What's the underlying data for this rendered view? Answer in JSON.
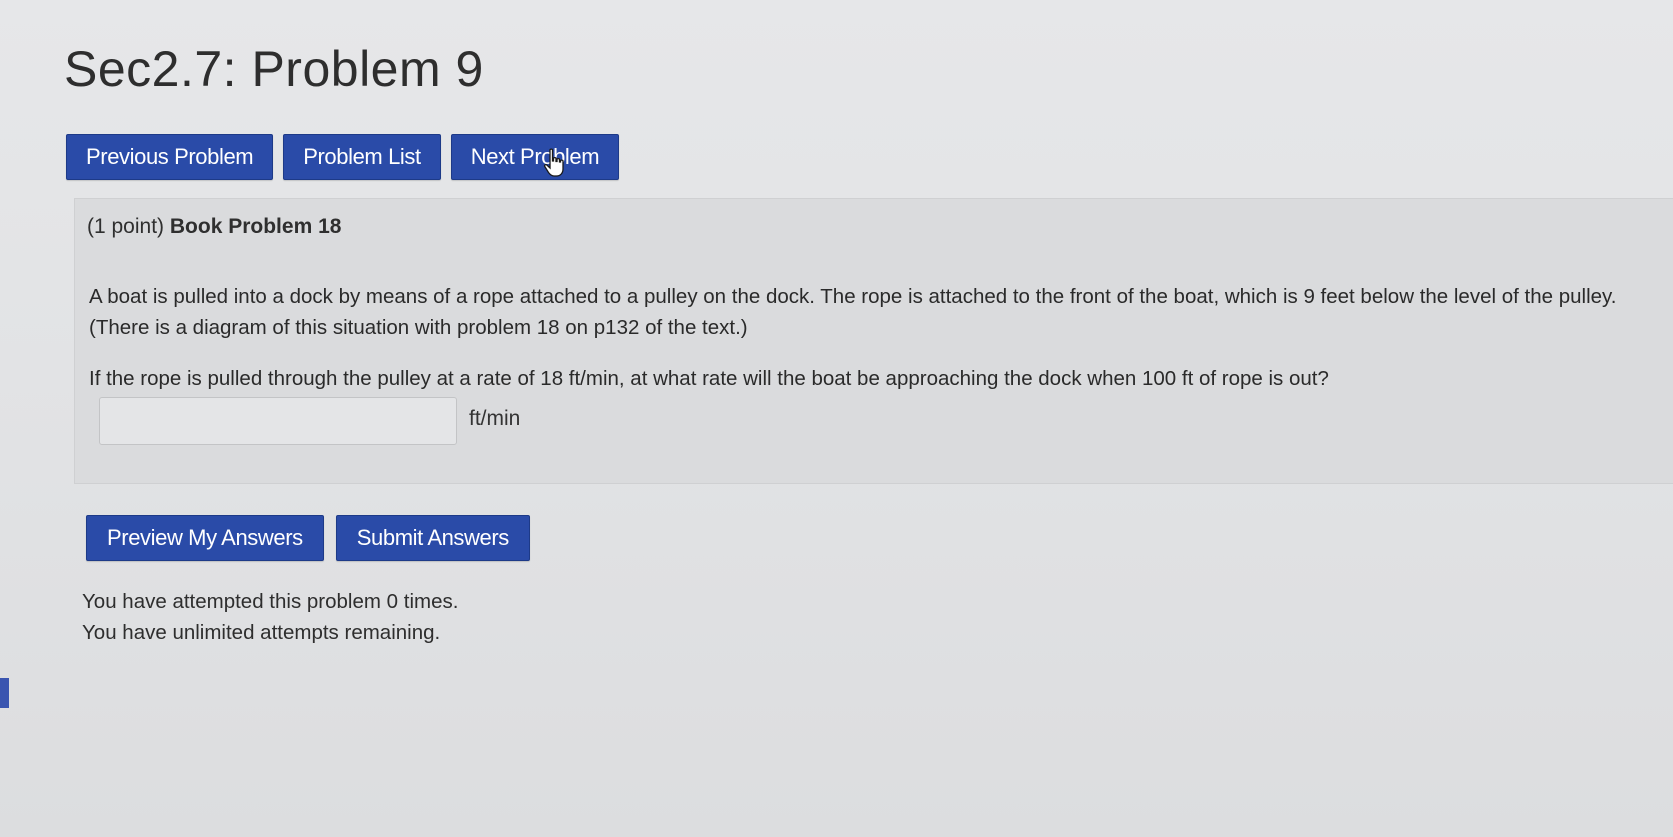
{
  "page": {
    "title": "Sec2.7: Problem 9"
  },
  "nav": {
    "previous_label": "Previous Problem",
    "list_label": "Problem List",
    "next_label": "Next Problem"
  },
  "problem": {
    "points": "(1 point)",
    "source": "Book Problem 18",
    "statement": "A boat is pulled into a dock by means of a rope attached to a pulley on the dock. The rope is attached to the front of the boat, which is 9 feet below the level of the pulley. (There is a diagram of this situation with problem 18 on p132 of the text.)",
    "question": "If the rope is pulled through the pulley at a rate of 18 ft/min, at what rate will the boat be approaching the dock when 100 ft of rope is out?",
    "answer_value": "",
    "answer_unit": "ft/min"
  },
  "actions": {
    "preview_label": "Preview My Answers",
    "submit_label": "Submit Answers"
  },
  "status": {
    "attempts_line": "You have attempted this problem 0 times.",
    "remaining_line": "You have unlimited attempts remaining."
  },
  "colors": {
    "button_blue": "#2a4ba8",
    "panel_bg": "#dadbdd",
    "page_bg": "#e3e4e6"
  },
  "icons": {
    "cursor": "hand-pointer-icon"
  }
}
